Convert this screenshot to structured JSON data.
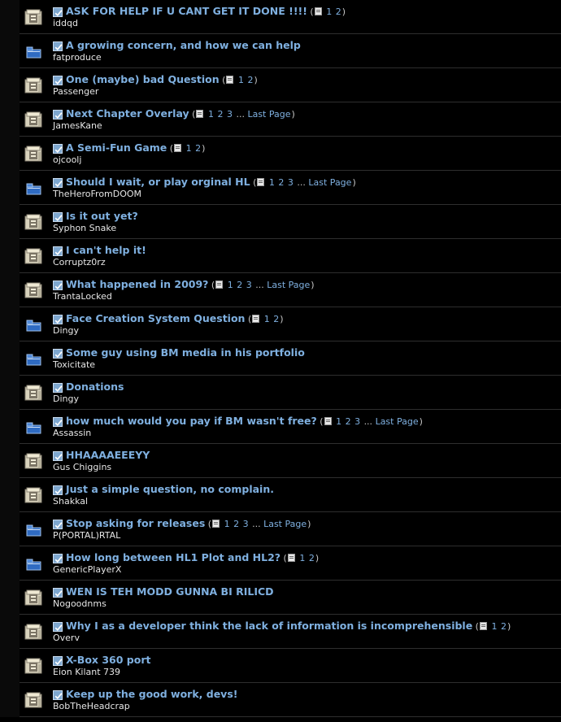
{
  "threads": [
    {
      "title": "ASK FOR HELP IF U CANT GET IT DONE !!!!",
      "author": "iddqd",
      "icon": "hot-folder-icon",
      "pages": [
        "1",
        "2"
      ],
      "last_page": ""
    },
    {
      "title": "A growing concern, and how we can help",
      "author": "fatproduce",
      "icon": "folder-icon",
      "pages": [],
      "last_page": ""
    },
    {
      "title": "One (maybe) bad Question",
      "author": "Passenger",
      "icon": "hot-folder-icon",
      "pages": [
        "1",
        "2"
      ],
      "last_page": ""
    },
    {
      "title": "Next Chapter Overlay",
      "author": "JamesKane",
      "icon": "hot-folder-icon",
      "pages": [
        "1",
        "2",
        "3"
      ],
      "last_page": "Last Page"
    },
    {
      "title": "A Semi-Fun Game",
      "author": "ojcoolj",
      "icon": "hot-folder-icon",
      "pages": [
        "1",
        "2"
      ],
      "last_page": ""
    },
    {
      "title": "Should I wait, or play orginal HL",
      "author": "TheHeroFromDOOM",
      "icon": "folder-icon",
      "pages": [
        "1",
        "2",
        "3"
      ],
      "last_page": "Last Page"
    },
    {
      "title": "Is it out yet?",
      "author": "Syphon Snake",
      "icon": "hot-folder-icon",
      "pages": [],
      "last_page": ""
    },
    {
      "title": "I can't help it!",
      "author": "Corruptz0rz",
      "icon": "hot-folder-icon",
      "pages": [],
      "last_page": ""
    },
    {
      "title": "What happened in 2009?",
      "author": "TrantaLocked",
      "icon": "hot-folder-icon",
      "pages": [
        "1",
        "2",
        "3"
      ],
      "last_page": "Last Page"
    },
    {
      "title": "Face Creation System Question",
      "author": "Dingy",
      "icon": "folder-icon",
      "pages": [
        "1",
        "2"
      ],
      "last_page": ""
    },
    {
      "title": "Some guy using BM media in his portfolio",
      "author": "Toxicitate",
      "icon": "folder-icon",
      "pages": [],
      "last_page": ""
    },
    {
      "title": "Donations",
      "author": "Dingy",
      "icon": "hot-folder-icon",
      "pages": [],
      "last_page": ""
    },
    {
      "title": "how much would you pay if BM wasn't free?",
      "author": "Assassin",
      "icon": "folder-icon",
      "pages": [
        "1",
        "2",
        "3"
      ],
      "last_page": "Last Page"
    },
    {
      "title": "HHAAAAEEEYY",
      "author": "Gus Chiggins",
      "icon": "hot-folder-icon",
      "pages": [],
      "last_page": ""
    },
    {
      "title": "Just a simple question, no complain.",
      "author": "Shakkal",
      "icon": "hot-folder-icon",
      "pages": [],
      "last_page": ""
    },
    {
      "title": "Stop asking for releases",
      "author": "P(PORTAL)RTAL",
      "icon": "folder-icon",
      "pages": [
        "1",
        "2",
        "3"
      ],
      "last_page": "Last Page"
    },
    {
      "title": "How long between HL1 Plot and HL2?",
      "author": "GenericPlayerX",
      "icon": "folder-icon",
      "pages": [
        "1",
        "2"
      ],
      "last_page": ""
    },
    {
      "title": "WEN IS TEH MODD GUNNA BI RILICD",
      "author": "Nogoodnms",
      "icon": "hot-folder-icon",
      "pages": [],
      "last_page": ""
    },
    {
      "title": "Why I as a developer think the lack of information is incomprehensible",
      "author": "Overv",
      "icon": "hot-folder-icon",
      "pages": [
        "1",
        "2"
      ],
      "last_page": ""
    },
    {
      "title": "X-Box 360 port",
      "author": "Eion Kilant 739",
      "icon": "hot-folder-icon",
      "pages": [],
      "last_page": ""
    },
    {
      "title": "Keep up the good work, devs!",
      "author": "BobTheHeadcrap",
      "icon": "hot-folder-icon",
      "pages": [],
      "last_page": ""
    }
  ],
  "ellipsis": "...",
  "colors": {
    "background": "#000000",
    "title_link": "#7fb0e0",
    "author_text": "#e6e6e6",
    "separator": "#2e2e2e"
  }
}
